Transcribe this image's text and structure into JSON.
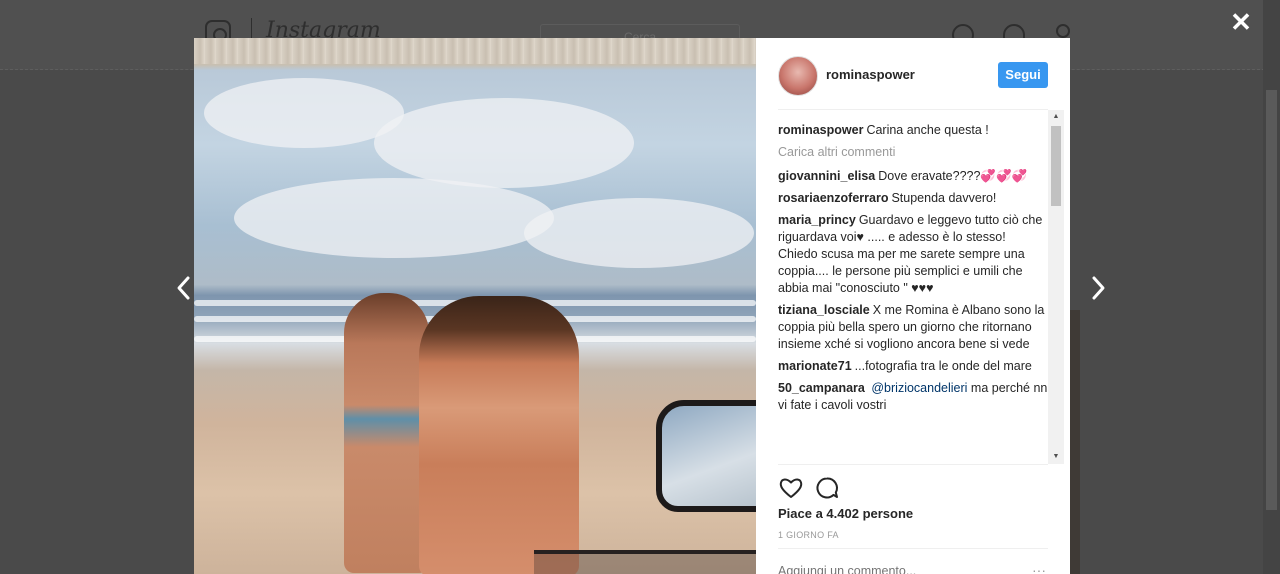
{
  "background": {
    "app_name": "Instagram",
    "search_placeholder": "Cerca"
  },
  "close_label": "✕",
  "post": {
    "username": "rominaspower",
    "follow_label": "Segui",
    "caption": {
      "author": "rominaspower",
      "text": "Carina anche questa !"
    },
    "load_more_label": "Carica altri commenti",
    "comments": [
      {
        "author": "giovannini_elisa",
        "text": "Dove eravate????💞💞💞"
      },
      {
        "author": "rosariaenzoferraro",
        "text": "Stupenda davvero!"
      },
      {
        "author": "maria_princy",
        "text": "Guardavo e leggevo tutto ciò che riguardava voi♥ ..... e adesso è lo stesso! Chiedo scusa ma per me sarete sempre una coppia.... le persone più semplici e umili che abbia mai \"conosciuto \" ♥♥♥"
      },
      {
        "author": "tiziana_losciale",
        "text": "X me Romina è Albano sono la coppia più bella spero un giorno che ritornano insieme xché si vogliono ancora bene si vede"
      },
      {
        "author": "marionate71",
        "text": "...fotografia tra le onde del mare"
      },
      {
        "author": "50_campanara",
        "mention": "@briziocandelieri",
        "text": " ma perché nn vi fate i cavoli vostri"
      }
    ],
    "likes_label": "Piace a 4.402 persone",
    "time_ago": "1 GIORNO FA",
    "add_comment_placeholder": "Aggiungi un commento...",
    "more_label": "···"
  }
}
